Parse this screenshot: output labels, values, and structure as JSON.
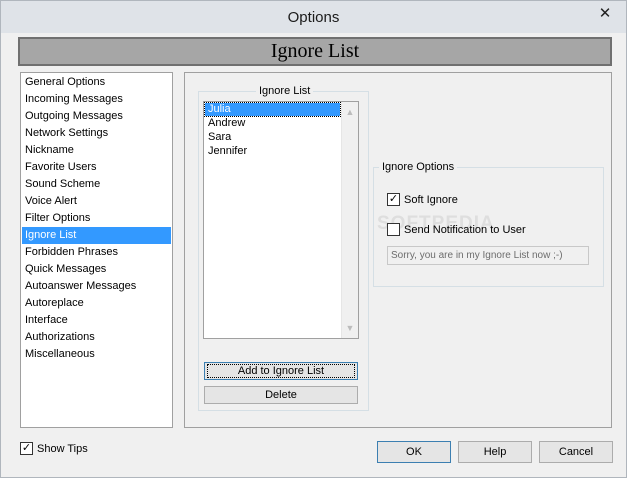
{
  "window": {
    "title": "Options",
    "close_glyph": "✕"
  },
  "header": {
    "title": "Ignore List"
  },
  "nav": {
    "items": [
      {
        "label": "General Options"
      },
      {
        "label": "Incoming Messages"
      },
      {
        "label": "Outgoing Messages"
      },
      {
        "label": "Network Settings"
      },
      {
        "label": "Nickname"
      },
      {
        "label": "Favorite Users"
      },
      {
        "label": "Sound Scheme"
      },
      {
        "label": "Voice Alert"
      },
      {
        "label": "Filter Options"
      },
      {
        "label": "Ignore List",
        "selected": true
      },
      {
        "label": "Forbidden Phrases"
      },
      {
        "label": "Quick Messages"
      },
      {
        "label": "Autoanswer Messages"
      },
      {
        "label": "Autoreplace"
      },
      {
        "label": "Interface"
      },
      {
        "label": "Authorizations"
      },
      {
        "label": "Miscellaneous"
      }
    ]
  },
  "ignore_list": {
    "group_label": "Ignore List",
    "entries": [
      "Julia",
      "Andrew",
      "Sara",
      "Jennifer"
    ],
    "selected_entry": "Julia",
    "add_button": "Add to Ignore List",
    "delete_button": "Delete"
  },
  "ignore_options": {
    "group_label": "Ignore Options",
    "soft_ignore": {
      "label": "Soft Ignore",
      "checked": true
    },
    "send_notification": {
      "label": "Send Notification to User",
      "checked": false
    },
    "notification_message": "Sorry, you are in my Ignore List now ;-)"
  },
  "watermark": "SOFTPEDIA",
  "footer": {
    "show_tips": {
      "label": "Show Tips",
      "checked": true
    },
    "ok_button": "OK",
    "help_button": "Help",
    "cancel_button": "Cancel"
  },
  "colors": {
    "selection": "#3399ff",
    "header_panel": "#a6a6a6",
    "titlebar": "#dfe3e8"
  }
}
